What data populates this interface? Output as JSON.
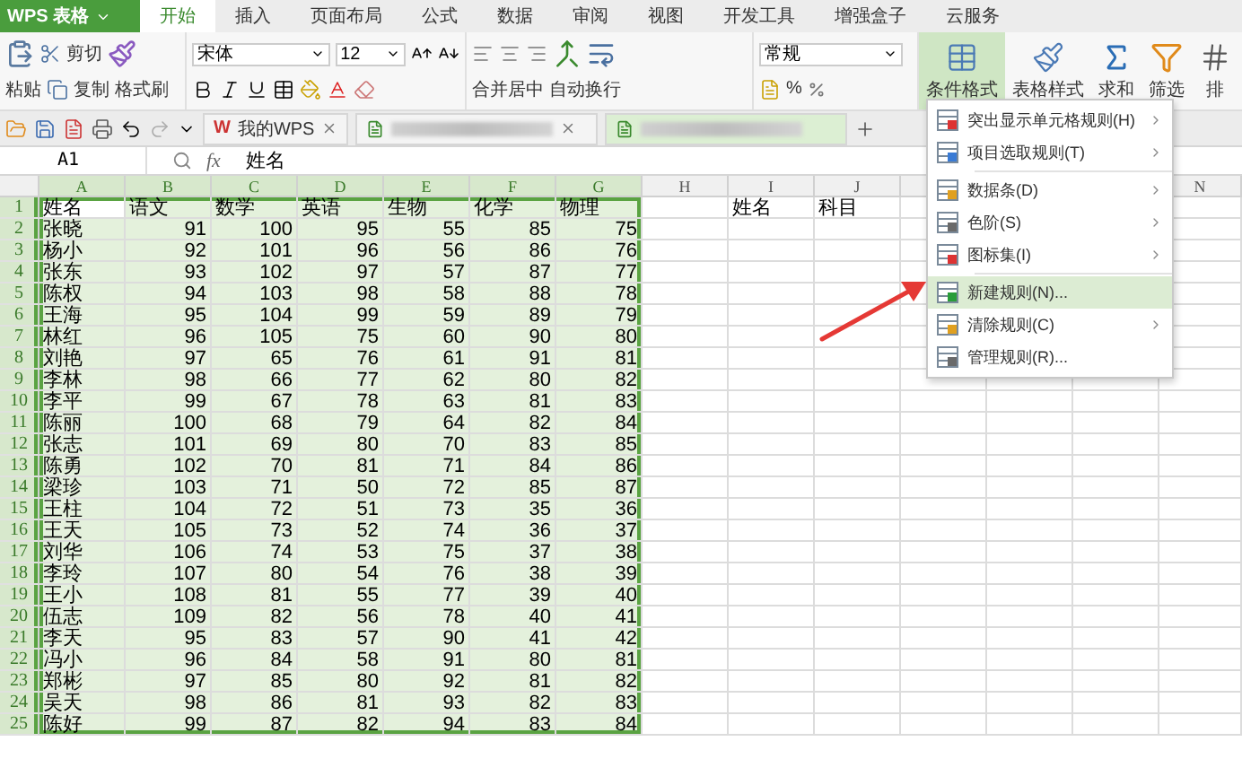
{
  "app": {
    "logo": "WPS 表格"
  },
  "menu_tabs": [
    {
      "label": "开始",
      "selected": true
    },
    {
      "label": "插入",
      "selected": false
    },
    {
      "label": "页面布局",
      "selected": false
    },
    {
      "label": "公式",
      "selected": false
    },
    {
      "label": "数据",
      "selected": false
    },
    {
      "label": "审阅",
      "selected": false
    },
    {
      "label": "视图",
      "selected": false
    },
    {
      "label": "开发工具",
      "selected": false
    },
    {
      "label": "增强盒子",
      "selected": false
    },
    {
      "label": "云服务",
      "selected": false
    }
  ],
  "ribbon": {
    "paste": "粘贴",
    "cut": "剪切",
    "copy": "复制",
    "format_painter": "格式刷",
    "font_name": "宋体",
    "font_size": "12",
    "merge": "合并居中",
    "wrap": "自动换行",
    "number_format": "常规",
    "percent": "%",
    "large_buttons": [
      {
        "kind": "conditional",
        "label": "条件格式",
        "pressed": true
      },
      {
        "kind": "style",
        "label": "表格样式",
        "pressed": false
      },
      {
        "kind": "sum",
        "label": "求和",
        "pressed": false
      },
      {
        "kind": "filter",
        "label": "筛选",
        "pressed": false
      },
      {
        "kind": "sort",
        "label": "排",
        "pressed": false
      }
    ]
  },
  "doc_tabs": [
    {
      "kind": "home",
      "mark": "W",
      "label": "我的WPS",
      "selected": false
    },
    {
      "kind": "blurred",
      "selected": false
    },
    {
      "kind": "blurred",
      "selected": true
    }
  ],
  "formula_bar": {
    "cell": "A1",
    "fx": "fx",
    "value": "姓名"
  },
  "sheet": {
    "columns": [
      {
        "label": "A",
        "selected": true
      },
      {
        "label": "B",
        "selected": true
      },
      {
        "label": "C",
        "selected": true
      },
      {
        "label": "D",
        "selected": true
      },
      {
        "label": "E",
        "selected": true
      },
      {
        "label": "F",
        "selected": true
      },
      {
        "label": "G",
        "selected": true
      },
      {
        "label": "H",
        "selected": false
      },
      {
        "label": "I",
        "selected": false
      },
      {
        "label": "J",
        "selected": false
      }
    ],
    "far_columns": [
      {
        "label": "N",
        "selected": false
      }
    ],
    "side_headers": [
      "姓名",
      "科目"
    ],
    "rows": [
      {
        "number": "1",
        "kind": "header",
        "selected": true,
        "active": true,
        "cells": [
          "姓名",
          "语文",
          "数学",
          "英语",
          "生物",
          "化学",
          "物理"
        ]
      },
      {
        "number": "2",
        "kind": "data",
        "selected": true,
        "active": false,
        "cells": [
          "张晓",
          "91",
          "100",
          "95",
          "55",
          "85",
          "75"
        ]
      },
      {
        "number": "3",
        "kind": "data",
        "selected": true,
        "active": false,
        "cells": [
          "杨小",
          "92",
          "101",
          "96",
          "56",
          "86",
          "76"
        ]
      },
      {
        "number": "4",
        "kind": "data",
        "selected": true,
        "active": false,
        "cells": [
          "张东",
          "93",
          "102",
          "97",
          "57",
          "87",
          "77"
        ]
      },
      {
        "number": "5",
        "kind": "data",
        "selected": true,
        "active": false,
        "cells": [
          "陈权",
          "94",
          "103",
          "98",
          "58",
          "88",
          "78"
        ]
      },
      {
        "number": "6",
        "kind": "data",
        "selected": true,
        "active": false,
        "cells": [
          "王海",
          "95",
          "104",
          "99",
          "59",
          "89",
          "79"
        ]
      },
      {
        "number": "7",
        "kind": "data",
        "selected": true,
        "active": false,
        "cells": [
          "林红",
          "96",
          "105",
          "75",
          "60",
          "90",
          "80"
        ]
      },
      {
        "number": "8",
        "kind": "data",
        "selected": true,
        "active": false,
        "cells": [
          "刘艳",
          "97",
          "65",
          "76",
          "61",
          "91",
          "81"
        ]
      },
      {
        "number": "9",
        "kind": "data",
        "selected": true,
        "active": false,
        "cells": [
          "李林",
          "98",
          "66",
          "77",
          "62",
          "80",
          "82"
        ]
      },
      {
        "number": "10",
        "kind": "data",
        "selected": true,
        "active": false,
        "cells": [
          "李平",
          "99",
          "67",
          "78",
          "63",
          "81",
          "83"
        ]
      },
      {
        "number": "11",
        "kind": "data",
        "selected": true,
        "active": false,
        "cells": [
          "陈丽",
          "100",
          "68",
          "79",
          "64",
          "82",
          "84"
        ]
      },
      {
        "number": "12",
        "kind": "data",
        "selected": true,
        "active": false,
        "cells": [
          "张志",
          "101",
          "69",
          "80",
          "70",
          "83",
          "85"
        ]
      },
      {
        "number": "13",
        "kind": "data",
        "selected": true,
        "active": false,
        "cells": [
          "陈勇",
          "102",
          "70",
          "81",
          "71",
          "84",
          "86"
        ]
      },
      {
        "number": "14",
        "kind": "data",
        "selected": true,
        "active": false,
        "cells": [
          "梁珍",
          "103",
          "71",
          "50",
          "72",
          "85",
          "87"
        ]
      },
      {
        "number": "15",
        "kind": "data",
        "selected": true,
        "active": false,
        "cells": [
          "王柱",
          "104",
          "72",
          "51",
          "73",
          "35",
          "36"
        ]
      },
      {
        "number": "16",
        "kind": "data",
        "selected": true,
        "active": false,
        "cells": [
          "王天",
          "105",
          "73",
          "52",
          "74",
          "36",
          "37"
        ]
      },
      {
        "number": "17",
        "kind": "data",
        "selected": true,
        "active": false,
        "cells": [
          "刘华",
          "106",
          "74",
          "53",
          "75",
          "37",
          "38"
        ]
      },
      {
        "number": "18",
        "kind": "data",
        "selected": true,
        "active": false,
        "cells": [
          "李玲",
          "107",
          "80",
          "54",
          "76",
          "38",
          "39"
        ]
      },
      {
        "number": "19",
        "kind": "data",
        "selected": true,
        "active": false,
        "cells": [
          "王小",
          "108",
          "81",
          "55",
          "77",
          "39",
          "40"
        ]
      },
      {
        "number": "20",
        "kind": "data",
        "selected": true,
        "active": false,
        "cells": [
          "伍志",
          "109",
          "82",
          "56",
          "78",
          "40",
          "41"
        ]
      },
      {
        "number": "21",
        "kind": "data",
        "selected": true,
        "active": false,
        "cells": [
          "李天",
          "95",
          "83",
          "57",
          "90",
          "41",
          "42"
        ]
      },
      {
        "number": "22",
        "kind": "data",
        "selected": true,
        "active": false,
        "cells": [
          "冯小",
          "96",
          "84",
          "58",
          "91",
          "80",
          "81"
        ]
      },
      {
        "number": "23",
        "kind": "data",
        "selected": true,
        "active": false,
        "cells": [
          "郑彬",
          "97",
          "85",
          "80",
          "92",
          "81",
          "82"
        ]
      },
      {
        "number": "24",
        "kind": "data",
        "selected": true,
        "active": false,
        "cells": [
          "吴天",
          "98",
          "86",
          "81",
          "93",
          "82",
          "83"
        ]
      },
      {
        "number": "25",
        "kind": "data",
        "selected": true,
        "active": false,
        "cells": [
          "陈好",
          "99",
          "87",
          "82",
          "94",
          "83",
          "84"
        ]
      }
    ]
  },
  "context_menu": [
    {
      "kind": "item",
      "label": "突出显示单元格规则(H)",
      "submenu": true,
      "highlighted": false
    },
    {
      "kind": "item",
      "label": "项目选取规则(T)",
      "submenu": true,
      "highlighted": false
    },
    {
      "kind": "separator"
    },
    {
      "kind": "item",
      "label": "数据条(D)",
      "submenu": true,
      "highlighted": false
    },
    {
      "kind": "item",
      "label": "色阶(S)",
      "submenu": true,
      "highlighted": false
    },
    {
      "kind": "item",
      "label": "图标集(I)",
      "submenu": true,
      "highlighted": false
    },
    {
      "kind": "separator"
    },
    {
      "kind": "item",
      "label": "新建规则(N)...",
      "submenu": false,
      "highlighted": true
    },
    {
      "kind": "item",
      "label": "清除规则(C)",
      "submenu": true,
      "highlighted": false
    },
    {
      "kind": "item",
      "label": "管理规则(R)...",
      "submenu": false,
      "highlighted": false
    }
  ],
  "annotation": {
    "kind": "arrow"
  }
}
